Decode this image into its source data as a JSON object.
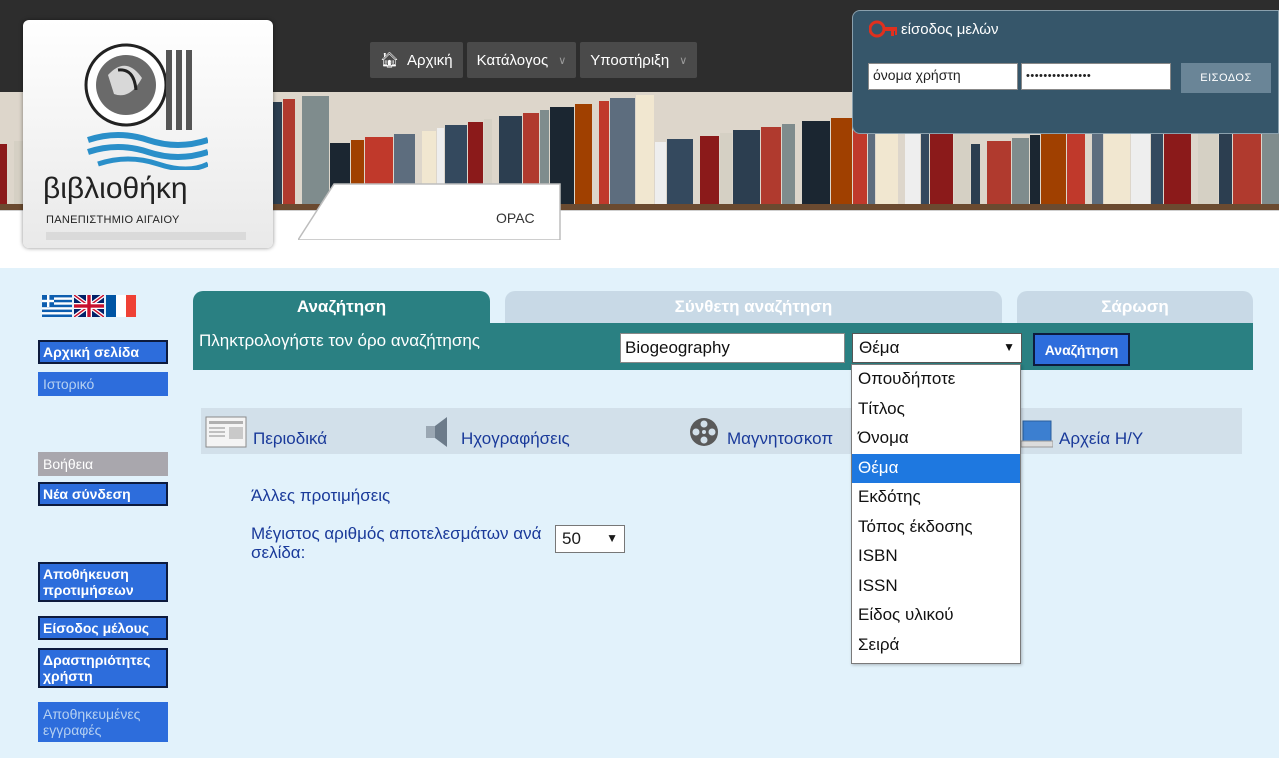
{
  "header": {
    "logo_title": "βιβλιοθήκη",
    "logo_subtitle": "ΠΑΝΕΠΙΣΤΗΜΙΟ ΑΙΓΑΙΟΥ",
    "nav": {
      "home": "Αρχική",
      "catalog": "Κατάλογος",
      "support": "Υποστήριξη"
    },
    "opac_tab": "OPAC"
  },
  "login": {
    "title": "είσοδος μελών",
    "username_value": "όνομα χρήστη",
    "password_value": "•••••••••••••••",
    "button": "ΕΙΣΟΔΟΣ"
  },
  "sidebar": {
    "languages": [
      "greek-flag",
      "uk-flag",
      "france-flag"
    ],
    "items": [
      {
        "label": "Αρχική σελίδα",
        "state": "active"
      },
      {
        "label": "Ιστορικό",
        "state": "dim"
      },
      {
        "label": "Βοήθεια",
        "state": "gray"
      },
      {
        "label": "Νέα σύνδεση",
        "state": "active"
      },
      {
        "label": "Αποθήκευση προτιμήσεων",
        "state": "active"
      },
      {
        "label": "Είσοδος μέλους",
        "state": "active"
      },
      {
        "label": "Δραστηριότητες χρήστη",
        "state": "active"
      },
      {
        "label": "Αποθηκευμένες εγγραφές",
        "state": "dim"
      }
    ]
  },
  "tabs": [
    {
      "label": "Αναζήτηση",
      "active": true
    },
    {
      "label": "Σύνθετη αναζήτηση",
      "active": false
    },
    {
      "label": "Σάρωση",
      "active": false
    }
  ],
  "search": {
    "prompt": "Πληκτρολογήστε τον όρο αναζήτησης",
    "value": "Biogeography",
    "field_selected": "Θέμα",
    "button": "Αναζήτηση"
  },
  "field_options": [
    "Οπουδήποτε",
    "Τίτλος",
    "Όνομα",
    "Θέμα",
    "Εκδότης",
    "Τόπος έκδοσης",
    "ISBN",
    "ISSN",
    "Είδος υλικού",
    "Σειρά"
  ],
  "material_types": [
    "Περιοδικά",
    "Ηχογραφήσεις",
    "Μαγνητοσκοπ",
    "Αρχεία Η/Υ"
  ],
  "preferences": {
    "title": "Άλλες προτιμήσεις",
    "max_results_label": "Μέγιστος αριθμός αποτελεσμάτων ανά σελίδα:",
    "max_results_value": "50"
  },
  "colors": {
    "teal": "#2a8082",
    "sidebar_blue": "#2d6ddc",
    "link_blue": "#1a3a9a",
    "main_bg": "#e2f2fb",
    "login_panel": "#36566a",
    "selected_option": "#1e78e0"
  }
}
